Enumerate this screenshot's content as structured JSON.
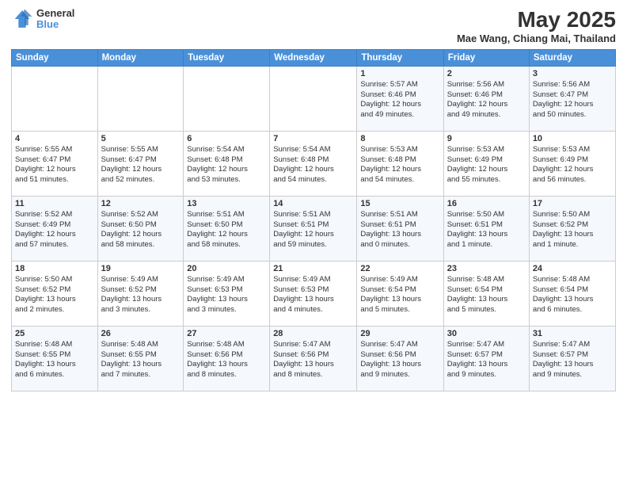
{
  "header": {
    "logo_general": "General",
    "logo_blue": "Blue",
    "month_title": "May 2025",
    "location": "Mae Wang, Chiang Mai, Thailand"
  },
  "weekdays": [
    "Sunday",
    "Monday",
    "Tuesday",
    "Wednesday",
    "Thursday",
    "Friday",
    "Saturday"
  ],
  "weeks": [
    [
      {
        "day": "",
        "info": ""
      },
      {
        "day": "",
        "info": ""
      },
      {
        "day": "",
        "info": ""
      },
      {
        "day": "",
        "info": ""
      },
      {
        "day": "1",
        "info": "Sunrise: 5:57 AM\nSunset: 6:46 PM\nDaylight: 12 hours\nand 49 minutes."
      },
      {
        "day": "2",
        "info": "Sunrise: 5:56 AM\nSunset: 6:46 PM\nDaylight: 12 hours\nand 49 minutes."
      },
      {
        "day": "3",
        "info": "Sunrise: 5:56 AM\nSunset: 6:47 PM\nDaylight: 12 hours\nand 50 minutes."
      }
    ],
    [
      {
        "day": "4",
        "info": "Sunrise: 5:55 AM\nSunset: 6:47 PM\nDaylight: 12 hours\nand 51 minutes."
      },
      {
        "day": "5",
        "info": "Sunrise: 5:55 AM\nSunset: 6:47 PM\nDaylight: 12 hours\nand 52 minutes."
      },
      {
        "day": "6",
        "info": "Sunrise: 5:54 AM\nSunset: 6:48 PM\nDaylight: 12 hours\nand 53 minutes."
      },
      {
        "day": "7",
        "info": "Sunrise: 5:54 AM\nSunset: 6:48 PM\nDaylight: 12 hours\nand 54 minutes."
      },
      {
        "day": "8",
        "info": "Sunrise: 5:53 AM\nSunset: 6:48 PM\nDaylight: 12 hours\nand 54 minutes."
      },
      {
        "day": "9",
        "info": "Sunrise: 5:53 AM\nSunset: 6:49 PM\nDaylight: 12 hours\nand 55 minutes."
      },
      {
        "day": "10",
        "info": "Sunrise: 5:53 AM\nSunset: 6:49 PM\nDaylight: 12 hours\nand 56 minutes."
      }
    ],
    [
      {
        "day": "11",
        "info": "Sunrise: 5:52 AM\nSunset: 6:49 PM\nDaylight: 12 hours\nand 57 minutes."
      },
      {
        "day": "12",
        "info": "Sunrise: 5:52 AM\nSunset: 6:50 PM\nDaylight: 12 hours\nand 58 minutes."
      },
      {
        "day": "13",
        "info": "Sunrise: 5:51 AM\nSunset: 6:50 PM\nDaylight: 12 hours\nand 58 minutes."
      },
      {
        "day": "14",
        "info": "Sunrise: 5:51 AM\nSunset: 6:51 PM\nDaylight: 12 hours\nand 59 minutes."
      },
      {
        "day": "15",
        "info": "Sunrise: 5:51 AM\nSunset: 6:51 PM\nDaylight: 13 hours\nand 0 minutes."
      },
      {
        "day": "16",
        "info": "Sunrise: 5:50 AM\nSunset: 6:51 PM\nDaylight: 13 hours\nand 1 minute."
      },
      {
        "day": "17",
        "info": "Sunrise: 5:50 AM\nSunset: 6:52 PM\nDaylight: 13 hours\nand 1 minute."
      }
    ],
    [
      {
        "day": "18",
        "info": "Sunrise: 5:50 AM\nSunset: 6:52 PM\nDaylight: 13 hours\nand 2 minutes."
      },
      {
        "day": "19",
        "info": "Sunrise: 5:49 AM\nSunset: 6:52 PM\nDaylight: 13 hours\nand 3 minutes."
      },
      {
        "day": "20",
        "info": "Sunrise: 5:49 AM\nSunset: 6:53 PM\nDaylight: 13 hours\nand 3 minutes."
      },
      {
        "day": "21",
        "info": "Sunrise: 5:49 AM\nSunset: 6:53 PM\nDaylight: 13 hours\nand 4 minutes."
      },
      {
        "day": "22",
        "info": "Sunrise: 5:49 AM\nSunset: 6:54 PM\nDaylight: 13 hours\nand 5 minutes."
      },
      {
        "day": "23",
        "info": "Sunrise: 5:48 AM\nSunset: 6:54 PM\nDaylight: 13 hours\nand 5 minutes."
      },
      {
        "day": "24",
        "info": "Sunrise: 5:48 AM\nSunset: 6:54 PM\nDaylight: 13 hours\nand 6 minutes."
      }
    ],
    [
      {
        "day": "25",
        "info": "Sunrise: 5:48 AM\nSunset: 6:55 PM\nDaylight: 13 hours\nand 6 minutes."
      },
      {
        "day": "26",
        "info": "Sunrise: 5:48 AM\nSunset: 6:55 PM\nDaylight: 13 hours\nand 7 minutes."
      },
      {
        "day": "27",
        "info": "Sunrise: 5:48 AM\nSunset: 6:56 PM\nDaylight: 13 hours\nand 8 minutes."
      },
      {
        "day": "28",
        "info": "Sunrise: 5:47 AM\nSunset: 6:56 PM\nDaylight: 13 hours\nand 8 minutes."
      },
      {
        "day": "29",
        "info": "Sunrise: 5:47 AM\nSunset: 6:56 PM\nDaylight: 13 hours\nand 9 minutes."
      },
      {
        "day": "30",
        "info": "Sunrise: 5:47 AM\nSunset: 6:57 PM\nDaylight: 13 hours\nand 9 minutes."
      },
      {
        "day": "31",
        "info": "Sunrise: 5:47 AM\nSunset: 6:57 PM\nDaylight: 13 hours\nand 9 minutes."
      }
    ]
  ]
}
